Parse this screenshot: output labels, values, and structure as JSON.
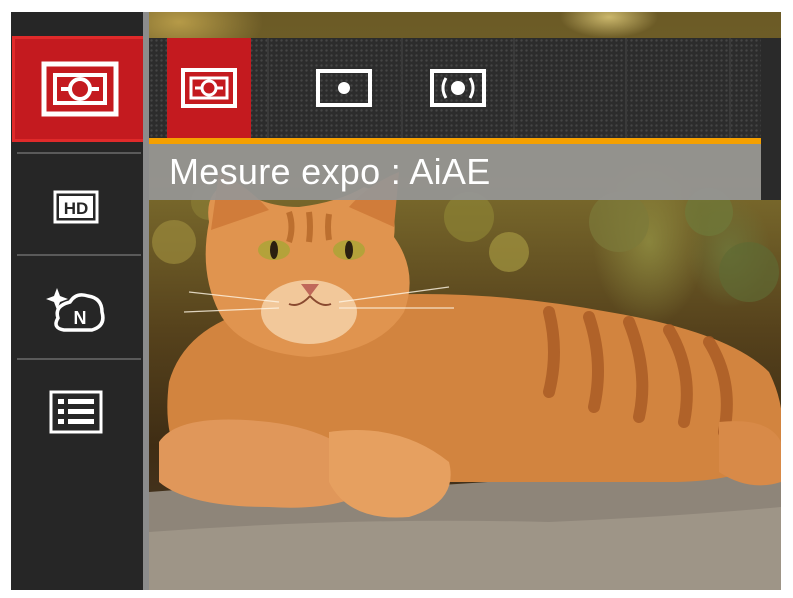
{
  "left_menu": {
    "items": [
      {
        "id": "metering",
        "icon": "metering-aiae-icon",
        "selected": true
      },
      {
        "id": "resolution",
        "icon": "hd-icon",
        "selected": false
      },
      {
        "id": "color-effect",
        "icon": "color-effect-normal-icon",
        "selected": false
      },
      {
        "id": "menu",
        "icon": "menu-list-icon",
        "selected": false
      }
    ]
  },
  "sub_menu": {
    "options": [
      {
        "id": "aiae",
        "icon": "metering-aiae-icon",
        "selected": true
      },
      {
        "id": "spot",
        "icon": "metering-spot-icon",
        "selected": false
      },
      {
        "id": "center",
        "icon": "metering-center-weighted-icon",
        "selected": false
      }
    ]
  },
  "status": {
    "label": "Mesure expo : AiAE"
  },
  "colors": {
    "selected": "#c41a1f",
    "highlight_bar": "#f5a000",
    "label_bg": "#969696"
  }
}
